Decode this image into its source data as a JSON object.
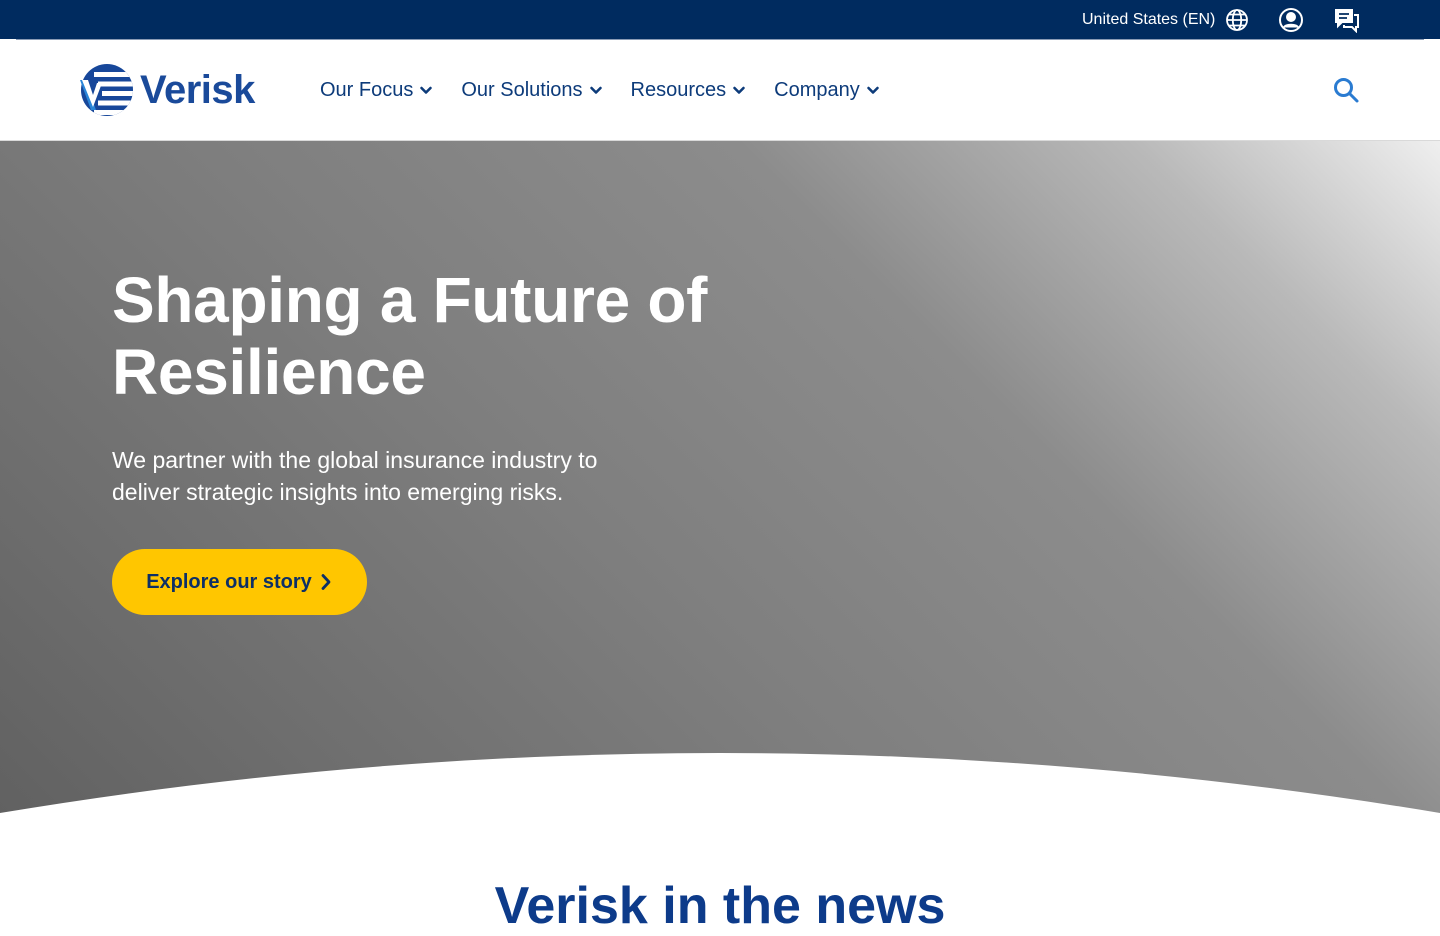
{
  "utility": {
    "region_label": "United States (EN)",
    "icons": [
      "globe-icon",
      "account-icon",
      "chat-icon"
    ]
  },
  "brand": {
    "name": "Verisk",
    "colors": {
      "navy": "#002b5f",
      "blue": "#1a4a9a",
      "nav_text": "#0d3b7a",
      "accent": "#ffc600",
      "search": "#2a7bd1"
    }
  },
  "nav": {
    "items": [
      {
        "label": "Our Focus"
      },
      {
        "label": "Our Solutions"
      },
      {
        "label": "Resources"
      },
      {
        "label": "Company"
      }
    ]
  },
  "hero": {
    "title": "Shaping a Future of Resilience",
    "description": "We partner with the global insurance industry to deliver strategic insights into emerging risks.",
    "cta_label": "Explore our story"
  },
  "news": {
    "title": "Verisk in the news"
  }
}
